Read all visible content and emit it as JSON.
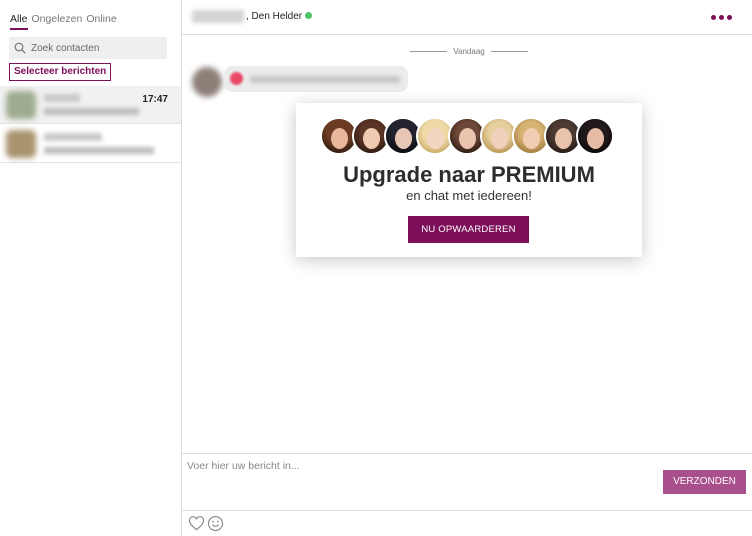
{
  "sidebar": {
    "tabs": [
      {
        "label": "Alle"
      },
      {
        "label": "Ongelezen"
      },
      {
        "label": "Online"
      }
    ],
    "search": {
      "placeholder": "Zoek contacten"
    },
    "select_button": "Selecteer berichten",
    "contacts": [
      {
        "time": "17:47"
      },
      {
        "time": ""
      }
    ]
  },
  "header": {
    "location": ", Den Helder",
    "status_color": "#4ec36a"
  },
  "chat": {
    "date_divider": "Vandaag"
  },
  "premium": {
    "title": "Upgrade naar PREMIUM",
    "subtitle": "en chat met iedereen!",
    "button": "NU OPWAARDEREN"
  },
  "composer": {
    "placeholder": "Voer hier uw bericht in...",
    "send_button": "VERZONDEN"
  },
  "colors": {
    "accent": "#7d0f5a",
    "send": "#a94f8c"
  },
  "icons": [
    "search-icon",
    "more-icon",
    "heart-icon",
    "smiley-icon"
  ]
}
